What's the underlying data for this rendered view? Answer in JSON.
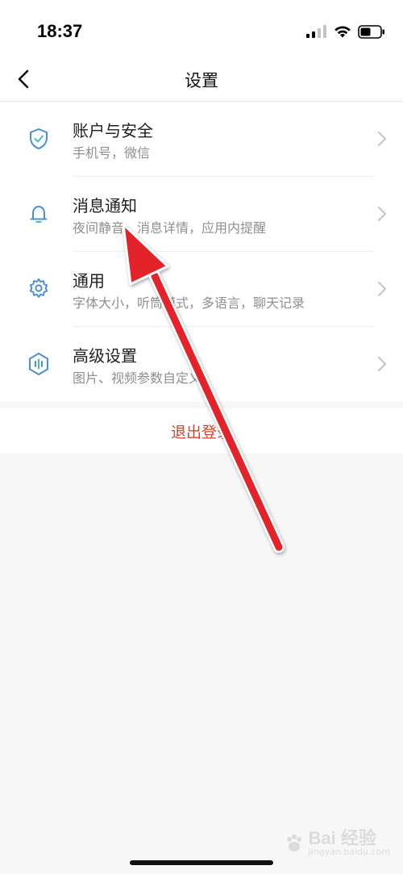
{
  "status_bar": {
    "time": "18:37"
  },
  "nav": {
    "title": "设置"
  },
  "settings": {
    "items": [
      {
        "title": "账户与安全",
        "subtitle": "手机号，微信"
      },
      {
        "title": "消息通知",
        "subtitle": "夜间静音、消息详情，应用内提醒"
      },
      {
        "title": "通用",
        "subtitle": "字体大小，听筒模式，多语言，聊天记录"
      },
      {
        "title": "高级设置",
        "subtitle": "图片、视频参数自定义"
      }
    ]
  },
  "logout": {
    "label": "退出登录"
  },
  "watermark": {
    "brand": "Bai 经验",
    "url": "jingyan.baidu.com"
  },
  "colors": {
    "icon_blue": "#4a8fd9",
    "logout_red": "#d8452e",
    "arrow_red": "#e3222b"
  }
}
